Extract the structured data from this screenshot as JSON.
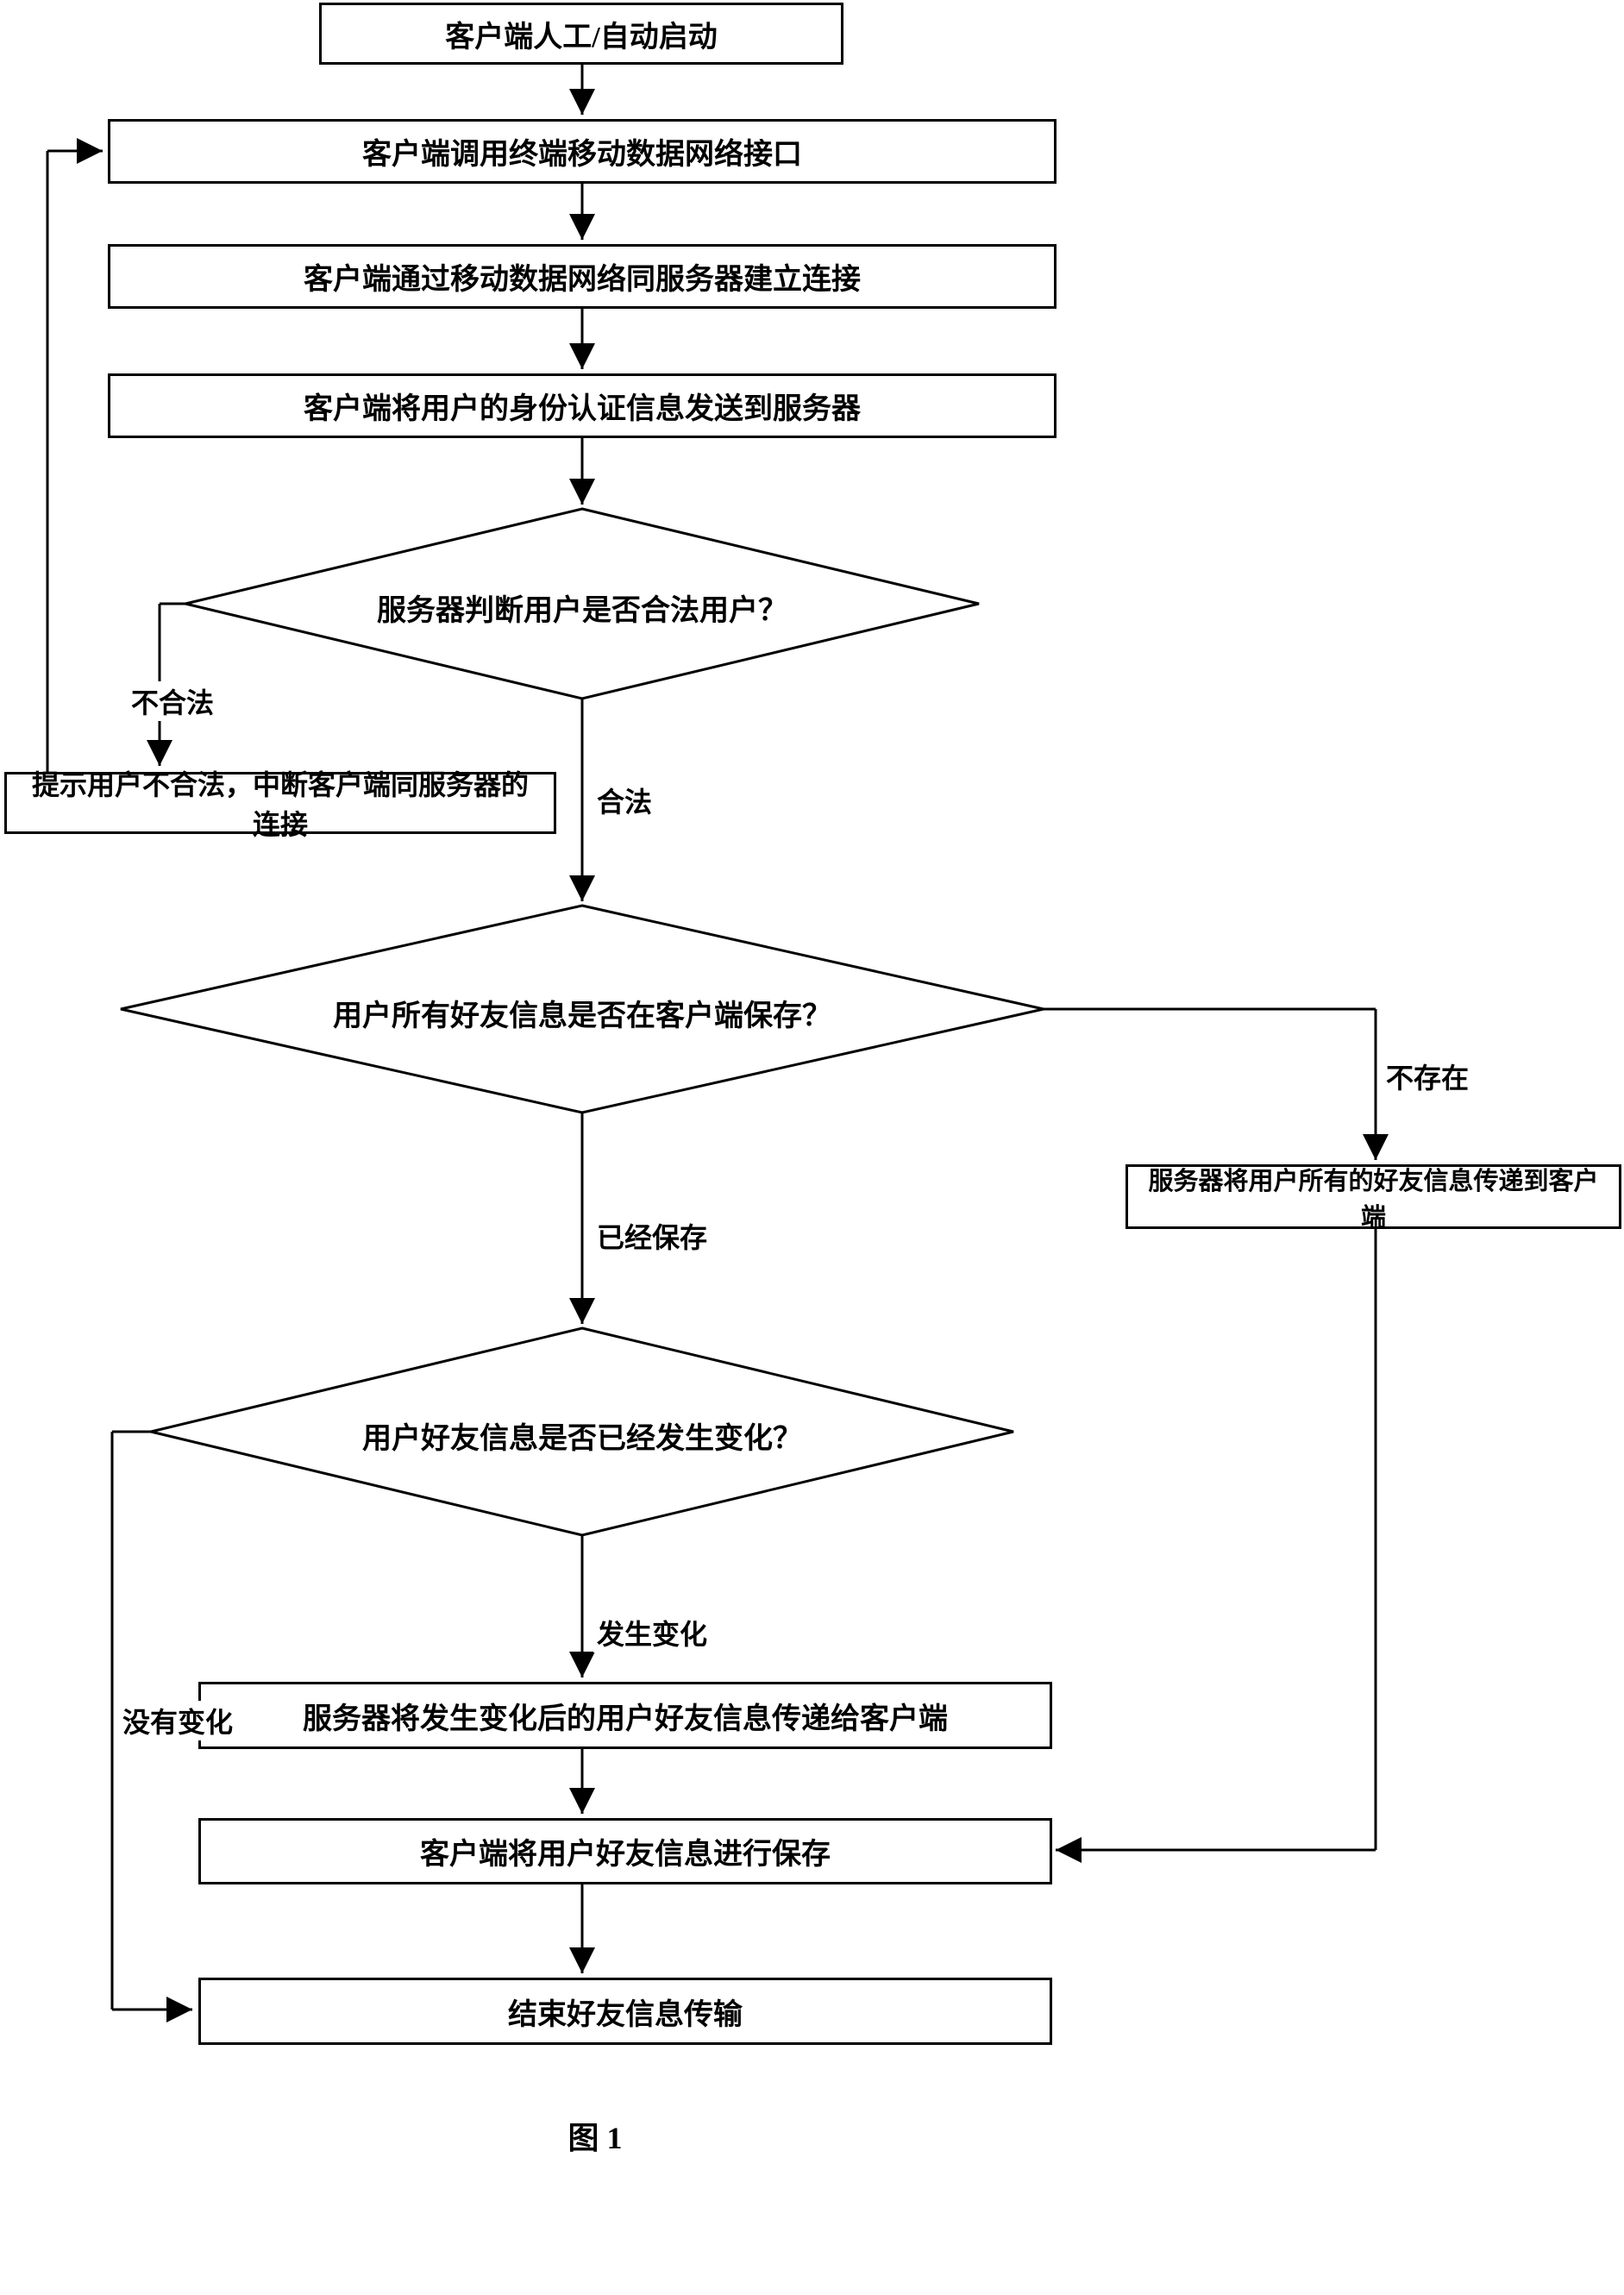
{
  "flowchart": {
    "nodes": {
      "start": "客户端人工/自动启动",
      "step1": "客户端调用终端移动数据网络接口",
      "step2": "客户端通过移动数据网络同服务器建立连接",
      "step3": "客户端将用户的身份认证信息发送到服务器",
      "decision1": "服务器判断用户是否合法用户？",
      "invalid_box": "提示用户不合法，中断客户端同服务器的连接",
      "decision2": "用户所有好友信息是否在客户端保存？",
      "not_exist_box": "服务器将用户所有的好友信息传递到客户端",
      "decision3": "用户好友信息是否已经发生变化？",
      "step4": "服务器将发生变化后的用户好友信息传递给客户端",
      "step5": "客户端将用户好友信息进行保存",
      "end": "结束好友信息传输"
    },
    "edge_labels": {
      "invalid": "不合法",
      "valid": "合法",
      "not_exist": "不存在",
      "saved": "已经保存",
      "changed": "发生变化",
      "no_change": "没有变化"
    },
    "figure_label": "图 1"
  }
}
